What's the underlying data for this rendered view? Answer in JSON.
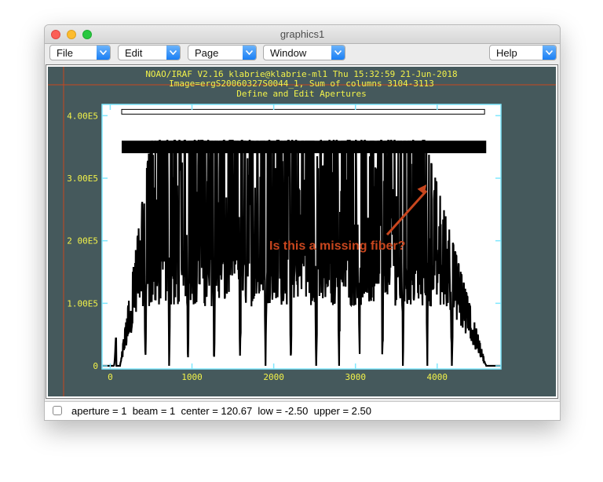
{
  "window": {
    "title": "graphics1"
  },
  "menus": [
    {
      "label": "File"
    },
    {
      "label": "Edit"
    },
    {
      "label": "Page"
    },
    {
      "label": "Window"
    },
    {
      "label": "Help"
    }
  ],
  "graph": {
    "header_lines": [
      "NOAO/IRAF V2.16 klabrie@klabrie-ml1 Thu 15:32:59 21-Jun-2018",
      "Image=ergS20060327S0044_1, Sum of columns 3104-3113",
      "Define and Edit Apertures"
    ],
    "annotation": "Is this a missing fiber?",
    "colors": {
      "background": "#45595c",
      "axes": "#7fe8ff",
      "text": "#f2f24a",
      "annotation": "#c8461e",
      "spectrum": "#000000"
    }
  },
  "chart_data": {
    "type": "line",
    "xlim": [
      -100,
      4780
    ],
    "ylim": [
      -5000,
      418000
    ],
    "x_ticks": [
      "0",
      "1000",
      "2000",
      "3000",
      "4000"
    ],
    "y_ticks": [
      "0",
      "1.00E5",
      "2 00E5",
      "3.00E5",
      "4.00E5"
    ],
    "fiber_region": [
      120,
      4600
    ],
    "gap_centers": [
      430,
      720,
      950,
      1270,
      1590,
      1900,
      2210,
      2520,
      2800,
      3050,
      3330,
      3580,
      3880,
      4180
    ],
    "annotated_x": 3850
  },
  "status": {
    "text": "aperture = 1  beam = 1  center = 120.67  low = -2.50  upper = 2.50"
  }
}
